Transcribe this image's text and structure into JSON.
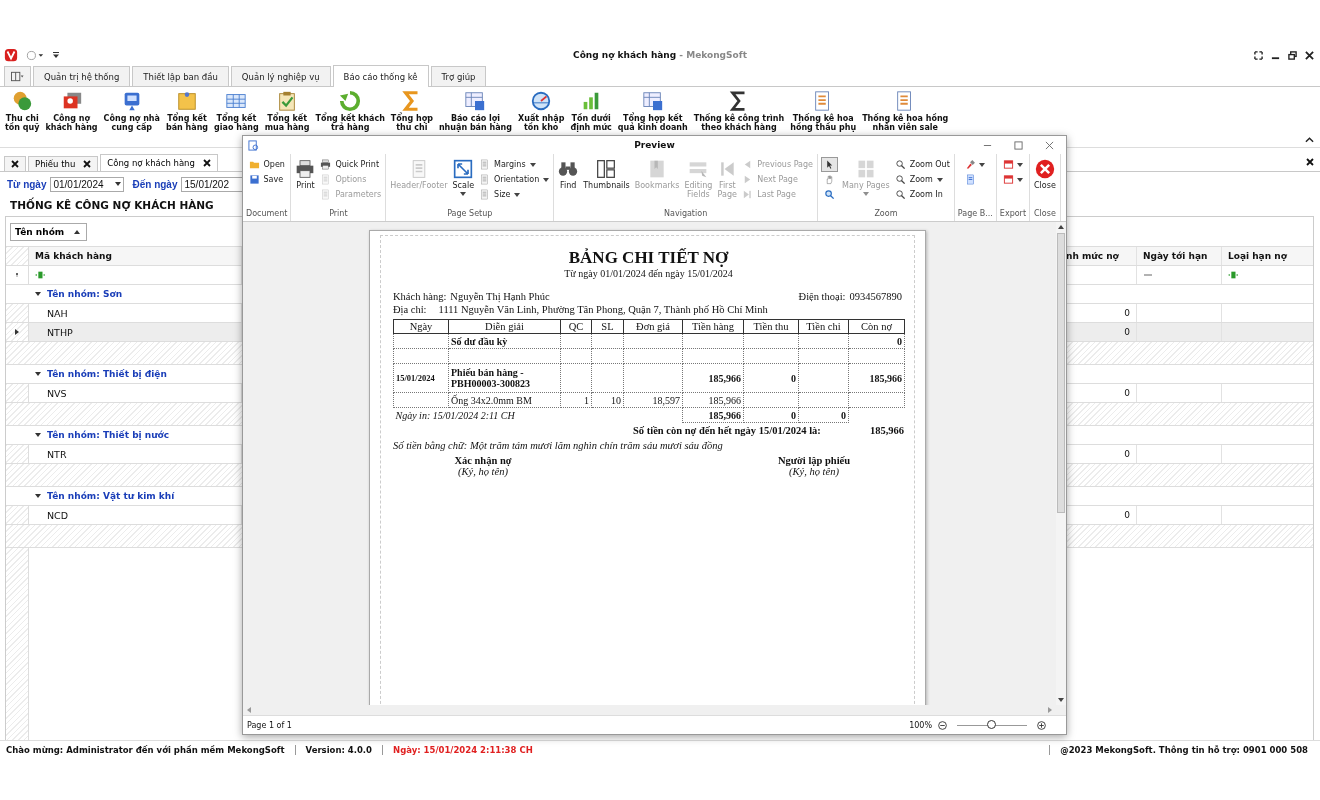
{
  "window": {
    "title": "Công nợ khách hàng",
    "app": " - MekongSoft"
  },
  "menu_tabs": [
    {
      "label": "Quản trị hệ thống",
      "selected": false
    },
    {
      "label": "Thiết lập ban đầu",
      "selected": false
    },
    {
      "label": "Quản lý nghiệp vụ",
      "selected": false
    },
    {
      "label": "Báo cáo thống kê",
      "selected": true
    },
    {
      "label": "Trợ giúp",
      "selected": false
    }
  ],
  "ribbon": [
    "Thu chi\ntồn quỹ",
    "Công nợ\nkhách hàng",
    "Công nợ nhà\ncung cấp",
    "Tổng kết\nbán hàng",
    "Tổng kết\ngiao hàng",
    "Tổng kết\nmua hàng",
    "Tổng kết khách\ntrả hàng",
    "Tổng hợp\nthu chi",
    "Báo cáo lợi\nnhuận bán hàng",
    "Xuất nhập\ntồn kho",
    "Tồn dưới\nđịnh mức",
    "Tổng hợp kết\nquả kinh doanh",
    "Thống kê công trình\ntheo khách hàng",
    "Thống kê hoa\nhồng thầu phụ",
    "Thống kê hoa hồng\nnhân viên sale"
  ],
  "doc_tabs": [
    {
      "label": "Phiếu thu",
      "selected": false
    },
    {
      "label": "Công nợ khách hàng",
      "selected": true
    }
  ],
  "filter": {
    "from_label": "Từ ngày",
    "from": "01/01/2024",
    "to_label": "Đến ngày",
    "to": "15/01/202"
  },
  "report_title": "THỐNG KÊ CÔNG NỢ KHÁCH HÀNG",
  "grid": {
    "group_by": "Tên nhóm",
    "columns": [
      "Mã khách hàng",
      "nh mức nợ",
      "Ngày tới hạn",
      "Loại hạn nợ"
    ],
    "groups": [
      {
        "label": "Tên nhóm: Sơn",
        "expanded": true,
        "rows": [
          {
            "code": "NAH",
            "limit": "0",
            "selected": false
          },
          {
            "code": "NTHP",
            "limit": "0",
            "selected": true
          }
        ]
      },
      {
        "label": "Tên nhóm: Thiết bị điện",
        "expanded": true,
        "rows": [
          {
            "code": "NVS",
            "limit": "0",
            "selected": false
          }
        ]
      },
      {
        "label": "Tên nhóm: Thiết bị nước",
        "expanded": true,
        "rows": [
          {
            "code": "NTR",
            "limit": "0",
            "selected": false
          }
        ]
      },
      {
        "label": "Tên nhóm: Vật tư kim khí",
        "expanded": true,
        "rows": [
          {
            "code": "NCD",
            "limit": "0",
            "selected": false
          }
        ]
      }
    ]
  },
  "preview": {
    "title": "Preview",
    "groups": [
      {
        "label": "Document",
        "items": [
          {
            "kind": "small",
            "label": "Open",
            "disabled": false
          },
          {
            "kind": "small",
            "label": "Save",
            "disabled": false
          }
        ]
      },
      {
        "label": "Print",
        "items": [
          {
            "kind": "large",
            "label": "Print",
            "disabled": false
          },
          {
            "kind": "small",
            "label": "Quick Print",
            "disabled": false
          },
          {
            "kind": "small",
            "label": "Options",
            "disabled": true
          },
          {
            "kind": "small",
            "label": "Parameters",
            "disabled": true
          }
        ]
      },
      {
        "label": "Page Setup",
        "items": [
          {
            "kind": "large",
            "label": "Header/Footer",
            "disabled": true
          },
          {
            "kind": "large",
            "label": "Scale",
            "disabled": false,
            "dropdown": true
          },
          {
            "kind": "small",
            "label": "Margins",
            "disabled": false,
            "dropdown": true
          },
          {
            "kind": "small",
            "label": "Orientation",
            "disabled": false,
            "dropdown": true
          },
          {
            "kind": "small",
            "label": "Size",
            "disabled": false,
            "dropdown": true
          }
        ]
      },
      {
        "label": "Navigation",
        "items": [
          {
            "kind": "large",
            "label": "Find",
            "disabled": false
          },
          {
            "kind": "large",
            "label": "Thumbnails",
            "disabled": false
          },
          {
            "kind": "large",
            "label": "Bookmarks",
            "disabled": true
          },
          {
            "kind": "large",
            "label": "Editing\nFields",
            "disabled": true
          },
          {
            "kind": "large",
            "label": "First\nPage",
            "disabled": true
          },
          {
            "kind": "small",
            "label": "Previous Page",
            "disabled": true
          },
          {
            "kind": "small",
            "label": "Next Page",
            "disabled": true
          },
          {
            "kind": "small",
            "label": "Last Page",
            "disabled": true
          }
        ]
      },
      {
        "label": "Zoom",
        "items": [
          {
            "kind": "tool",
            "selected": true
          },
          {
            "kind": "tool",
            "selected": false
          },
          {
            "kind": "tool",
            "selected": false
          },
          {
            "kind": "large",
            "label": "Many Pages",
            "disabled": true,
            "dropdown": true
          },
          {
            "kind": "small",
            "label": "Zoom Out",
            "disabled": false
          },
          {
            "kind": "small",
            "label": "Zoom",
            "disabled": false,
            "dropdown": true
          },
          {
            "kind": "small",
            "label": "Zoom In",
            "disabled": false
          }
        ]
      },
      {
        "label": "Page B...",
        "items": [
          {
            "kind": "tool",
            "dropdown": true
          },
          {
            "kind": "tool"
          }
        ]
      },
      {
        "label": "Export",
        "items": [
          {
            "kind": "tool",
            "dropdown": true
          },
          {
            "kind": "tool",
            "dropdown": true
          }
        ]
      },
      {
        "label": "Close",
        "items": [
          {
            "kind": "large",
            "label": "Close",
            "disabled": false
          }
        ]
      }
    ],
    "page_status": "Page 1 of 1",
    "zoom": {
      "reading": "100%",
      "level": 0.5
    }
  },
  "document": {
    "title": "BẢNG CHI TIẾT NỢ",
    "subtitle": "Từ ngày 01/01/2024 đến ngày 15/01/2024",
    "customer_label": "Khách hàng:",
    "customer": "Nguyễn Thị Hạnh Phúc",
    "phone_label": "Điện thoại:",
    "phone": "0934567890",
    "address_label": "Địa chỉ:",
    "address": "1111 Nguyễn Văn Linh, Phường Tân Phong, Quận 7, Thành phố Hồ Chí Minh",
    "columns": [
      "Ngày",
      "Diễn giải",
      "QC",
      "SL",
      "Đơn giá",
      "Tiền hàng",
      "Tiền thu",
      "Tiền chi",
      "Còn nợ"
    ],
    "rows": [
      {
        "kind": "opening",
        "cells": [
          "",
          "Số dư đầu kỳ",
          "",
          "",
          "",
          "",
          "",
          "",
          "0"
        ]
      },
      {
        "kind": "blank",
        "cells": [
          "",
          "",
          "",
          "",
          "",
          "",
          "",
          "",
          ""
        ]
      },
      {
        "kind": "voucher",
        "cells": [
          "15/01/2024",
          "Phiếu bán hàng - PBH00003-300823",
          "",
          "",
          "",
          "185,966",
          "0",
          "",
          "185,966"
        ]
      },
      {
        "kind": "item",
        "cells": [
          "",
          "Ống 34x2.0mm BM",
          "1",
          "10",
          "18,597",
          "185,966",
          "",
          "",
          ""
        ]
      }
    ],
    "printed_on": "Ngày in: 15/01/2024 2:11 CH",
    "totals": [
      "185,966",
      "0",
      "0"
    ],
    "balance_label": "Số tiền còn nợ đến hết ngày 15/01/2024 là:",
    "balance": "185,966",
    "in_words": "Số tiền bằng chữ: Một trăm tám mươi lăm nghìn chín trăm sáu mươi sáu đồng",
    "signatures": [
      {
        "title": "Xác nhận nợ",
        "note": "(Ký, họ tên)"
      },
      {
        "title": "Người lập phiếu",
        "note": "(Ký, họ tên)"
      }
    ]
  },
  "status": {
    "welcome": "Chào mừng: Administrator đến với phần mềm MekongSoft",
    "version": "Version: 4.0.0",
    "date": "Ngày: 15/01/2024 2:11:38 CH",
    "support": "@2023 MekongSoft. Thông tin hỗ trợ: 0901 000 508"
  }
}
